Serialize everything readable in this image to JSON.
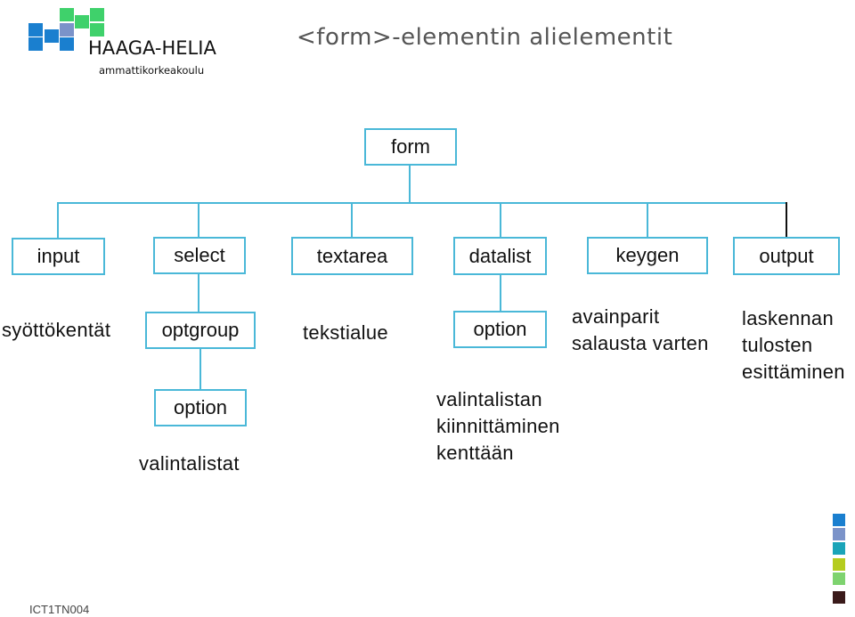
{
  "logo": {
    "name": "HAAGA-HELIA",
    "subtitle": "ammattikorkeakoulu",
    "colors": {
      "blue": "#1a7fcf",
      "periwinkle": "#7b93c9",
      "green": "#3fd16b"
    }
  },
  "title": "<form>-elementin alielementit",
  "diagram": {
    "root": {
      "label": "form"
    },
    "children": [
      {
        "label": "input",
        "description": "syöttökentät"
      },
      {
        "label": "select",
        "sub": "optgroup",
        "subsub": "option",
        "description": "valintalistat"
      },
      {
        "label": "textarea",
        "description": "tekstialue"
      },
      {
        "label": "datalist",
        "sub": "option",
        "description_lines": [
          "valintalistan",
          "kiinnittäminen",
          "kenttään"
        ]
      },
      {
        "label": "keygen",
        "description_lines": [
          "avainparit",
          "salausta varten"
        ]
      },
      {
        "label": "output",
        "description_lines": [
          "laskennan",
          "tulosten",
          "esittäminen"
        ]
      }
    ],
    "line_color": "#4ab8d8"
  },
  "footer": {
    "code": "ICT1TN004"
  },
  "palette": [
    "#1a7fcf",
    "#7b93c9",
    "#1aa4b8",
    "#b5cc1e",
    "#7ed36f",
    "#3a1a1a"
  ]
}
